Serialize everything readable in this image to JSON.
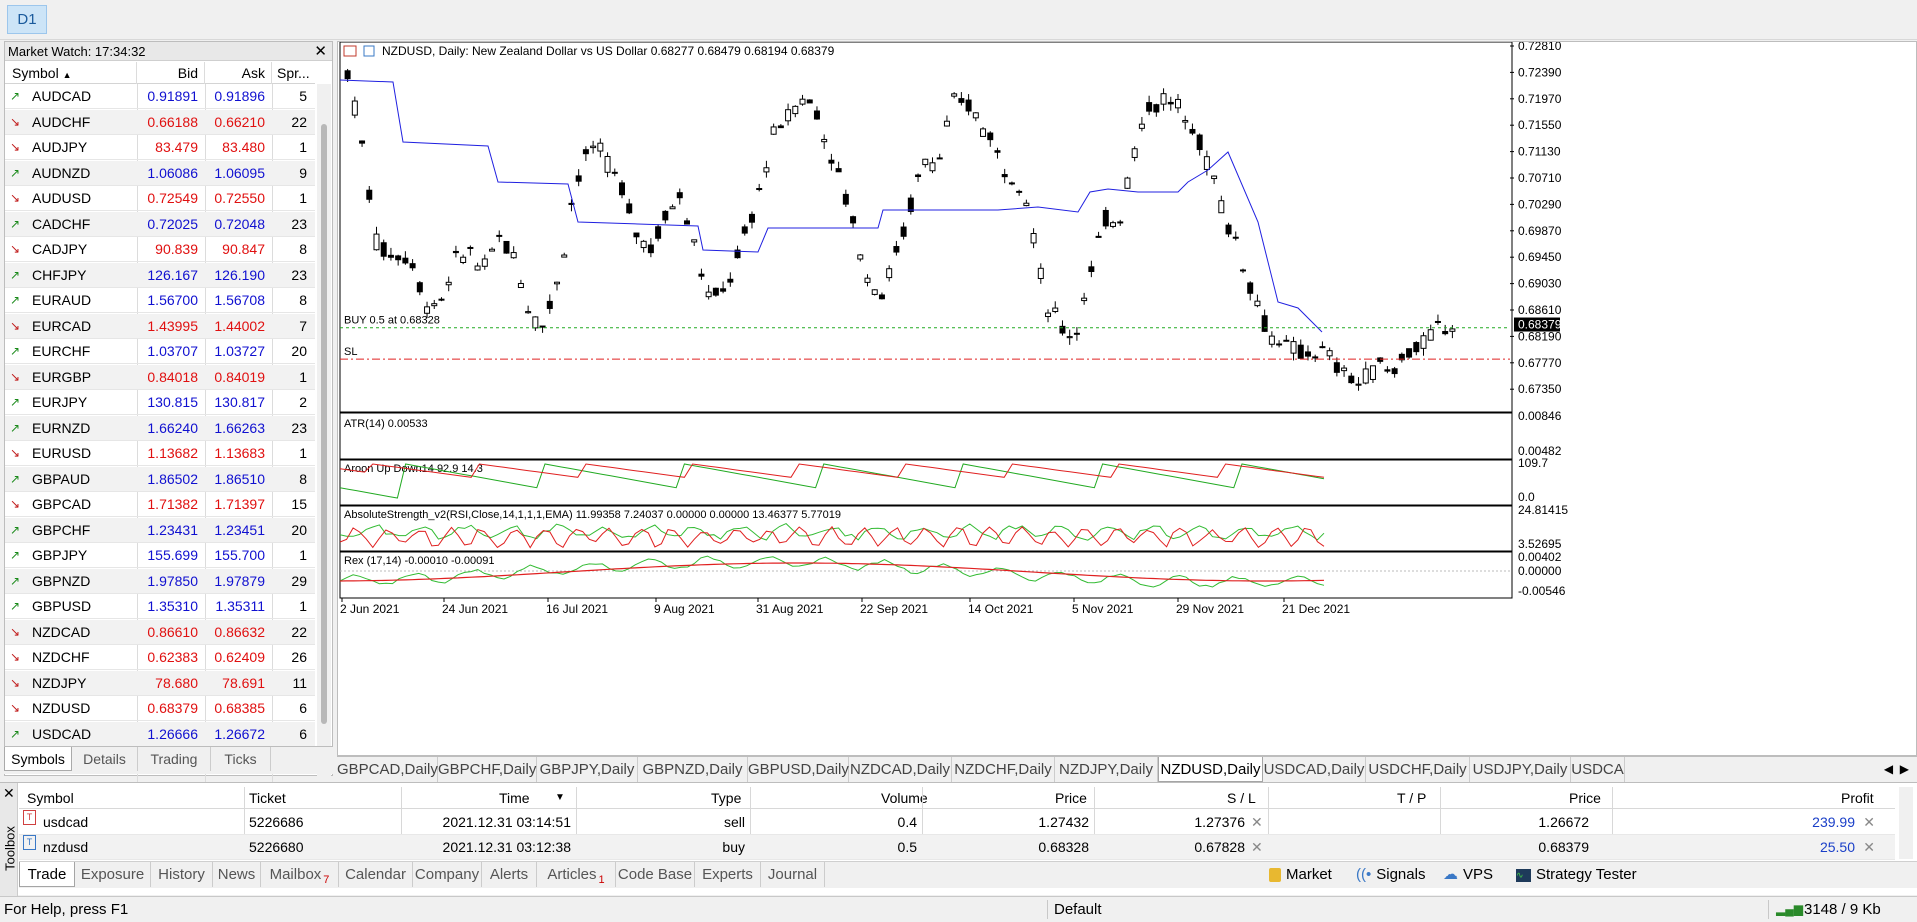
{
  "toolbar": {
    "timeframe_button": "D1"
  },
  "market_watch": {
    "title": "Market Watch: 17:34:32",
    "columns": {
      "symbol": "Symbol",
      "bid": "Bid",
      "ask": "Ask",
      "spread": "Spr..."
    },
    "rows": [
      {
        "symbol": "AUDCAD",
        "bid": "0.91891",
        "ask": "0.91896",
        "spread": "5",
        "dir": "up"
      },
      {
        "symbol": "AUDCHF",
        "bid": "0.66188",
        "ask": "0.66210",
        "spread": "22",
        "dir": "down"
      },
      {
        "symbol": "AUDJPY",
        "bid": "83.479",
        "ask": "83.480",
        "spread": "1",
        "dir": "down"
      },
      {
        "symbol": "AUDNZD",
        "bid": "1.06086",
        "ask": "1.06095",
        "spread": "9",
        "dir": "up"
      },
      {
        "symbol": "AUDUSD",
        "bid": "0.72549",
        "ask": "0.72550",
        "spread": "1",
        "dir": "down"
      },
      {
        "symbol": "CADCHF",
        "bid": "0.72025",
        "ask": "0.72048",
        "spread": "23",
        "dir": "up"
      },
      {
        "symbol": "CADJPY",
        "bid": "90.839",
        "ask": "90.847",
        "spread": "8",
        "dir": "down"
      },
      {
        "symbol": "CHFJPY",
        "bid": "126.167",
        "ask": "126.190",
        "spread": "23",
        "dir": "up"
      },
      {
        "symbol": "EURAUD",
        "bid": "1.56700",
        "ask": "1.56708",
        "spread": "8",
        "dir": "up"
      },
      {
        "symbol": "EURCAD",
        "bid": "1.43995",
        "ask": "1.44002",
        "spread": "7",
        "dir": "down"
      },
      {
        "symbol": "EURCHF",
        "bid": "1.03707",
        "ask": "1.03727",
        "spread": "20",
        "dir": "up"
      },
      {
        "symbol": "EURGBP",
        "bid": "0.84018",
        "ask": "0.84019",
        "spread": "1",
        "dir": "down"
      },
      {
        "symbol": "EURJPY",
        "bid": "130.815",
        "ask": "130.817",
        "spread": "2",
        "dir": "up"
      },
      {
        "symbol": "EURNZD",
        "bid": "1.66240",
        "ask": "1.66263",
        "spread": "23",
        "dir": "up"
      },
      {
        "symbol": "EURUSD",
        "bid": "1.13682",
        "ask": "1.13683",
        "spread": "1",
        "dir": "down"
      },
      {
        "symbol": "GBPAUD",
        "bid": "1.86502",
        "ask": "1.86510",
        "spread": "8",
        "dir": "up"
      },
      {
        "symbol": "GBPCAD",
        "bid": "1.71382",
        "ask": "1.71397",
        "spread": "15",
        "dir": "down"
      },
      {
        "symbol": "GBPCHF",
        "bid": "1.23431",
        "ask": "1.23451",
        "spread": "20",
        "dir": "up"
      },
      {
        "symbol": "GBPJPY",
        "bid": "155.699",
        "ask": "155.700",
        "spread": "1",
        "dir": "up"
      },
      {
        "symbol": "GBPNZD",
        "bid": "1.97850",
        "ask": "1.97879",
        "spread": "29",
        "dir": "up"
      },
      {
        "symbol": "GBPUSD",
        "bid": "1.35310",
        "ask": "1.35311",
        "spread": "1",
        "dir": "up"
      },
      {
        "symbol": "NZDCAD",
        "bid": "0.86610",
        "ask": "0.86632",
        "spread": "22",
        "dir": "down"
      },
      {
        "symbol": "NZDCHF",
        "bid": "0.62383",
        "ask": "0.62409",
        "spread": "26",
        "dir": "down"
      },
      {
        "symbol": "NZDJPY",
        "bid": "78.680",
        "ask": "78.691",
        "spread": "11",
        "dir": "down"
      },
      {
        "symbol": "NZDUSD",
        "bid": "0.68379",
        "ask": "0.68385",
        "spread": "6",
        "dir": "down"
      },
      {
        "symbol": "USDCAD",
        "bid": "1.26666",
        "ask": "1.26672",
        "spread": "6",
        "dir": "up"
      }
    ],
    "tabs": [
      "Symbols",
      "Details",
      "Trading",
      "Ticks"
    ],
    "active_tab": "Symbols"
  },
  "chart": {
    "header": "NZDUSD, Daily:  New Zealand Dollar vs US Dollar  0.68277 0.68479 0.68194 0.68379",
    "buy_label": "BUY 0.5 at 0.68328",
    "sl_label": "SL",
    "current_price": "0.68379",
    "price_ticks": [
      "0.72810",
      "0.72390",
      "0.71970",
      "0.71550",
      "0.71130",
      "0.70710",
      "0.70290",
      "0.69870",
      "0.69450",
      "0.69030",
      "0.68610",
      "0.68190",
      "0.67770",
      "0.67350"
    ],
    "atr_label": "ATR(14) 0.00533",
    "atr_ticks": [
      "0.00846",
      "0.00482"
    ],
    "aroon_label": "Aroon Up Down14 92.9 14.3",
    "aroon_ticks": [
      "109.7",
      "0.0"
    ],
    "abs_label": "AbsoluteStrength_v2(RSI,Close,14,1,1,1,EMA) 11.99358 7.24037 0.00000 0.00000 13.46377 5.77019",
    "abs_ticks": [
      "24.81415",
      "3.52695"
    ],
    "rex_label": "Rex (17,14) -0.00010 -0.00091",
    "rex_ticks": [
      "0.00402",
      "0.00000",
      "-0.00546"
    ],
    "date_ticks": [
      "2 Jun 2021",
      "24 Jun 2021",
      "16 Jul 2021",
      "9 Aug 2021",
      "31 Aug 2021",
      "22 Sep 2021",
      "14 Oct 2021",
      "5 Nov 2021",
      "29 Nov 2021",
      "21 Dec 2021"
    ],
    "colors": {
      "bull": "#000000",
      "trend_line": "#2020e0",
      "buy_line": "#22aa22",
      "sl_line": "#e02020",
      "aroon_up": "#22aa22",
      "aroon_down": "#e02020"
    }
  },
  "chart_tabs": [
    "GBPCAD,Daily",
    "GBPCHF,Daily",
    "GBPJPY,Daily",
    "GBPNZD,Daily",
    "GBPUSD,Daily",
    "NZDCAD,Daily",
    "NZDCHF,Daily",
    "NZDJPY,Daily",
    "NZDUSD,Daily",
    "USDCAD,Daily",
    "USDCHF,Daily",
    "USDJPY,Daily",
    "USDCA"
  ],
  "active_chart_tab": "NZDUSD,Daily",
  "toolbox": {
    "side_label": "Toolbox",
    "columns": {
      "symbol": "Symbol",
      "ticket": "Ticket",
      "time": "Time",
      "type": "Type",
      "volume": "Volume",
      "price": "Price",
      "sl": "S / L",
      "tp": "T / P",
      "cur_price": "Price",
      "profit": "Profit"
    },
    "rows": [
      {
        "symbol": "usdcad",
        "ticket": "5226686",
        "time": "2021.12.31 03:14:51",
        "type": "sell",
        "volume": "0.4",
        "price": "1.27432",
        "sl": "1.27376",
        "tp": "",
        "cur_price": "1.26672",
        "profit": "239.99",
        "icon": "T",
        "icon_color": "red"
      },
      {
        "symbol": "nzdusd",
        "ticket": "5226680",
        "time": "2021.12.31 03:12:38",
        "type": "buy",
        "volume": "0.5",
        "price": "0.68328",
        "sl": "0.67828",
        "tp": "",
        "cur_price": "0.68379",
        "profit": "25.50",
        "icon": "T",
        "icon_color": "blue"
      }
    ],
    "tabs": [
      "Trade",
      "Exposure",
      "History",
      "News",
      "Mailbox",
      "Calendar",
      "Company",
      "Alerts",
      "Articles",
      "Code Base",
      "Experts",
      "Journal"
    ],
    "mailbox_badge": "7",
    "articles_badge": "1",
    "active_tab": "Trade",
    "right_tools": [
      "Market",
      "Signals",
      "VPS",
      "Strategy Tester"
    ]
  },
  "status_bar": {
    "help": "For Help, press F1",
    "profile": "Default",
    "traffic": "3148 / 9 Kb"
  }
}
